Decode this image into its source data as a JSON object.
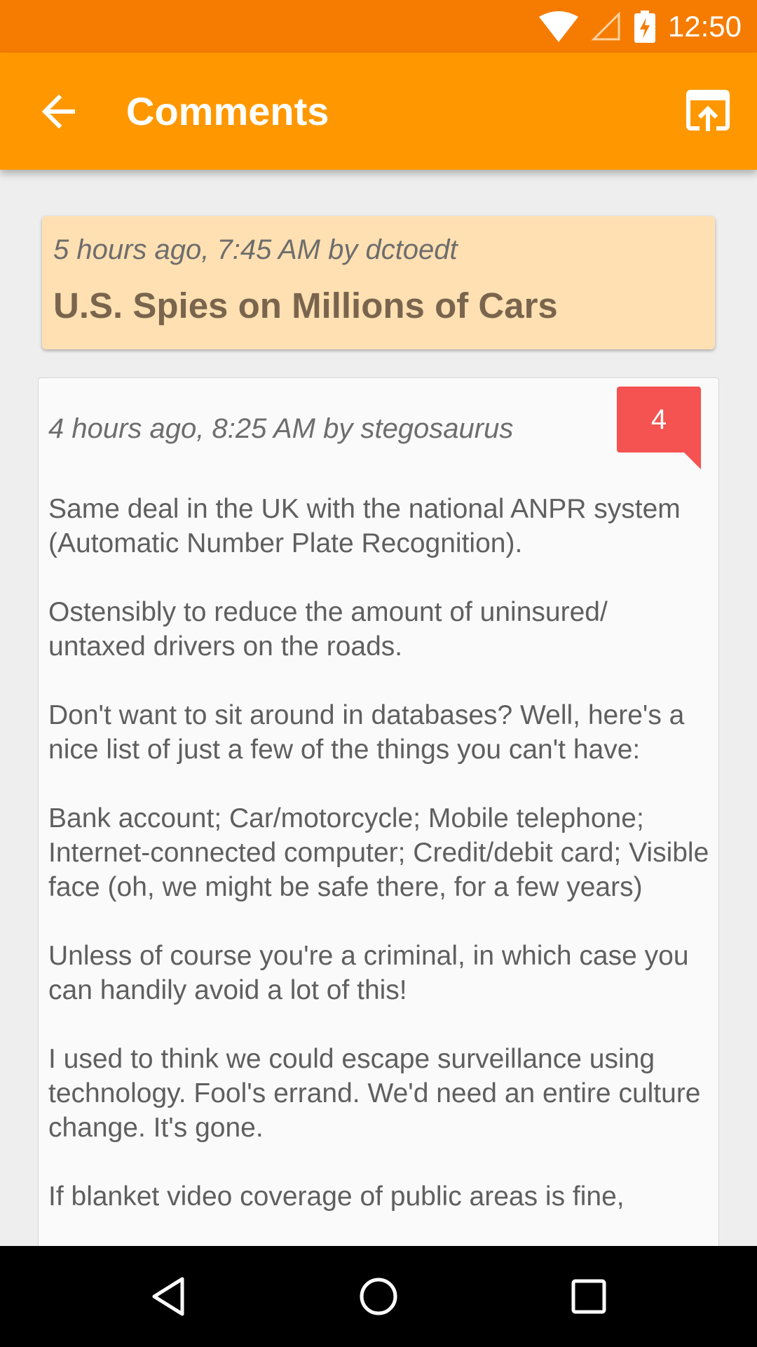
{
  "status_bar": {
    "time": "12:50",
    "icons": [
      "wifi-icon",
      "cell-signal-icon",
      "battery-charging-icon"
    ]
  },
  "app_bar": {
    "title": "Comments",
    "icons": [
      "arrow-back-icon",
      "open-in-browser-icon"
    ],
    "color": "#ff9800"
  },
  "story": {
    "meta": "5 hours ago, 7:45 AM by dctoedt",
    "title": "U.S. Spies on Millions of Cars"
  },
  "comment": {
    "meta": "4 hours ago, 8:25 AM by stegosaurus",
    "reply_count": "4",
    "paragraphs": [
      "Same deal in the UK with the national ANPR system (Automatic Number Plate Recognition).",
      "Ostensibly to reduce the amount of uninsured/ untaxed drivers on the roads.",
      "Don't want to sit around in databases? Well, here's a nice list of just a few of the things you can't have:",
      "Bank account; Car/motorcycle; Mobile telephone; Internet-connected computer; Credit/debit card; Visible face (oh, we might be safe there, for a few years)",
      "Unless of course you're a criminal, in which case you can handily avoid a lot of this!",
      "I used to think we could escape surveillance using technology. Fool's errand. We'd need an entire culture change. It's gone.",
      "If blanket video coverage of public areas is fine,"
    ]
  },
  "nav_bar": {
    "icons": [
      "back-triangle-icon",
      "home-circle-icon",
      "recents-square-icon"
    ]
  }
}
